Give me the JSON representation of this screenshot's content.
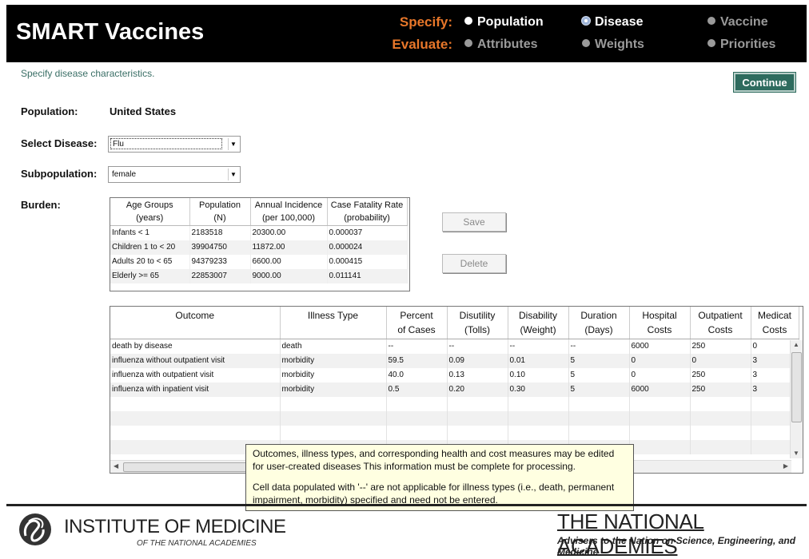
{
  "header": {
    "title": "SMART Vaccines",
    "specify_label": "Specify:",
    "evaluate_label": "Evaluate:",
    "specify_steps": [
      {
        "label": "Population",
        "state": "done"
      },
      {
        "label": "Disease",
        "state": "current"
      },
      {
        "label": "Vaccine",
        "state": "disabled"
      }
    ],
    "evaluate_steps": [
      {
        "label": "Attributes",
        "state": "disabled"
      },
      {
        "label": "Weights",
        "state": "disabled"
      },
      {
        "label": "Priorities",
        "state": "disabled"
      }
    ]
  },
  "instruction": "Specify disease characteristics.",
  "continue_label": "Continue",
  "form": {
    "population_label": "Population:",
    "population_value": "United States",
    "disease_label": "Select Disease:",
    "disease_value": "Flu",
    "subpop_label": "Subpopulation:",
    "subpop_value": "female",
    "burden_label": "Burden:"
  },
  "burden_table": {
    "headers": [
      [
        "Age Groups",
        "(years)"
      ],
      [
        "Population",
        "(N)"
      ],
      [
        "Annual Incidence",
        "(per 100,000)"
      ],
      [
        "Case Fatality Rate",
        "(probability)"
      ]
    ],
    "rows": [
      [
        "Infants < 1",
        "2183518",
        "20300.00",
        "0.000037"
      ],
      [
        "Children 1 to < 20",
        "39904750",
        "11872.00",
        "0.000024"
      ],
      [
        "Adults 20 to < 65",
        "94379233",
        "6600.00",
        "0.000415"
      ],
      [
        "Elderly >= 65",
        "22853007",
        "9000.00",
        "0.011141"
      ]
    ]
  },
  "buttons": {
    "save": "Save",
    "delete": "Delete"
  },
  "outcome_table": {
    "headers": [
      [
        "Outcome",
        ""
      ],
      [
        "Illness Type",
        ""
      ],
      [
        "Percent",
        "of Cases"
      ],
      [
        "Disutility",
        "(Tolls)"
      ],
      [
        "Disability",
        "(Weight)"
      ],
      [
        "Duration",
        "(Days)"
      ],
      [
        "Hospital",
        "Costs"
      ],
      [
        "Outpatient",
        "Costs"
      ],
      [
        "Medicat",
        "Costs"
      ]
    ],
    "rows": [
      [
        "death by disease",
        "death",
        "--",
        "--",
        "--",
        "--",
        "6000",
        "250",
        "0"
      ],
      [
        "influenza without outpatient visit",
        "morbidity",
        "59.5",
        "0.09",
        "0.01",
        "5",
        "0",
        "0",
        "3"
      ],
      [
        "influenza with outpatient visit",
        "morbidity",
        "40.0",
        "0.13",
        "0.10",
        "5",
        "0",
        "250",
        "3"
      ],
      [
        "influenza with inpatient visit",
        "morbidity",
        "0.5",
        "0.20",
        "0.30",
        "5",
        "6000",
        "250",
        "3"
      ],
      [
        "",
        "",
        "",
        "",
        "",
        "",
        "",
        "",
        ""
      ],
      [
        "",
        "",
        "",
        "",
        "",
        "",
        "",
        "",
        ""
      ],
      [
        "",
        "",
        "",
        "",
        "",
        "",
        "",
        "",
        ""
      ],
      [
        "",
        "",
        "",
        "",
        "",
        "",
        "",
        "",
        ""
      ]
    ]
  },
  "tooltip": {
    "line1": "Outcomes, illness types, and corresponding health and cost measures may be edited for user-created diseases This information must be complete for processing.",
    "line2": "Cell data populated with '--' are not applicable for illness types (i.e., death, permanent impairment, morbidity) specified and need not be entered."
  },
  "footer": {
    "iom_name": "INSTITUTE OF MEDICINE",
    "iom_sub": "OF THE NATIONAL ACADEMIES",
    "nas_name": "THE NATIONAL ACADEMIES",
    "nas_sub": "Advisers to the Nation on Science, Engineering, and Medicine"
  },
  "colors": {
    "header_bg": "#000000",
    "accent_orange": "#e8772a",
    "continue_green": "#2e6b5e",
    "tooltip_bg": "#ffffe1"
  }
}
